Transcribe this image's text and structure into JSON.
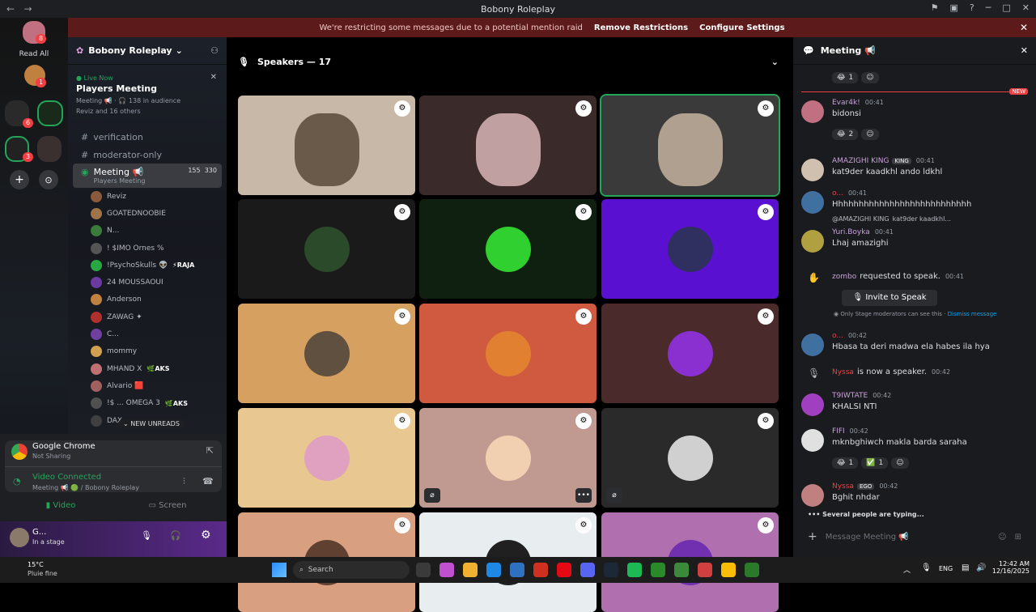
{
  "window": {
    "title": "Bobony Roleplay"
  },
  "banner": {
    "message": "We're restricting some messages due to a potential mention raid",
    "remove": "Remove Restrictions",
    "configure": "Configure Settings"
  },
  "servers": {
    "read_all": "Read All",
    "badge_top": "8",
    "badge_second": "1",
    "badge_group1": "6",
    "badge_group2": "3"
  },
  "guild": {
    "name": "Bobony Roleplay"
  },
  "live": {
    "tag": "Live Now",
    "name": "Players Meeting",
    "meta": "Meeting 📢 · 🎧 138 in audience",
    "others": "Reviz and 16 others"
  },
  "channels": [
    {
      "name": "verification"
    },
    {
      "name": "moderator-only"
    }
  ],
  "voice_channel": {
    "name": "Meeting 📢",
    "subtitle": "Players Meeting",
    "count1": "155",
    "count2": "330"
  },
  "voice_users": [
    {
      "name": "Reviz",
      "color": "#8b5a3c"
    },
    {
      "name": "GOATEDNOOBIE",
      "color": "#a0744a"
    },
    {
      "name": "N...",
      "color": "#3a7a3a"
    },
    {
      "name": "! $IMO Ornes %",
      "color": "#555"
    },
    {
      "name": "!PsychoSkulls 👽",
      "tag": "⚡RAJA",
      "color": "#27a844"
    },
    {
      "name": "24 MOUSSAOUI",
      "color": "#6a3aa0"
    },
    {
      "name": "Anderson",
      "color": "#c08040"
    },
    {
      "name": "ZAWAG ✦",
      "color": "#b03030"
    },
    {
      "name": "C...",
      "color": "#7040a0"
    },
    {
      "name": "mommy",
      "color": "#d0a050"
    },
    {
      "name": "MHAND X",
      "tag": "🌿AKS",
      "color": "#c07070"
    },
    {
      "name": "Alvario 🟥",
      "color": "#a06060"
    },
    {
      "name": "!$ ... OMEGA 3",
      "tag": "🌿AKS",
      "color": "#505050"
    },
    {
      "name": "DAX",
      "color": "#404040"
    }
  ],
  "new_unreads": "NEW UNREADS",
  "panel": {
    "chrome_title": "Google Chrome",
    "chrome_sub": "Not Sharing",
    "connected": "Video Connected",
    "connected_sub": "Meeting 📢 🟢 / Bobony Roleplay",
    "video": "Video",
    "screen": "Screen",
    "user_name": "G...",
    "user_status": "In a stage"
  },
  "stage": {
    "speakers_label": "Speakers — 17"
  },
  "tiles": [
    {
      "bg": "#c8b8a8",
      "av": "#6a5a4a"
    },
    {
      "bg": "#3a2a2a",
      "av": "#c0a0a0"
    },
    {
      "bg": "#3a3a3a",
      "av": "#b0a090"
    },
    {
      "bg": "#1a1a1a",
      "av": "#2a4a2a"
    },
    {
      "bg": "#102010",
      "av": "#2fd02f"
    },
    {
      "bg": "#5a10d0",
      "av": "#303060"
    },
    {
      "bg": "#d6a060",
      "av": "#605040"
    },
    {
      "bg": "#d05a40",
      "av": "#e08030"
    },
    {
      "bg": "#4a2a2a",
      "av": "#8a30d0"
    },
    {
      "bg": "#e8c890",
      "av": "#e0a0c0"
    },
    {
      "bg": "#c09a90",
      "av": "#f0d0b0"
    },
    {
      "bg": "#2a2a2a",
      "av": "#d0d0d0"
    },
    {
      "bg": "#d8a080",
      "av": "#604030"
    },
    {
      "bg": "#e8eef0",
      "av": "#202020"
    },
    {
      "bg": "#b070b0",
      "av": "#7030b0"
    }
  ],
  "chat": {
    "title": "Meeting 📢",
    "new_label": "NEW",
    "messages": [
      {
        "user": "Evar4k!",
        "time": "00:41",
        "text": "bidonsi",
        "color": "#c9a0dc",
        "av": "#c07080"
      },
      {
        "user": "AMAZIGHI KING",
        "tag": "KING",
        "time": "00:41",
        "text": "kat9der kaadkhl ando ldkhl",
        "color": "#c9a0dc",
        "av": "#d0c0b0"
      },
      {
        "user": "o...",
        "time": "00:41",
        "text": "Hhhhhhhhhhhhhhhhhhhhhhhhhhh",
        "color": "#f23f43",
        "av": "#4070a0"
      },
      {
        "user": "Yuri.Boyka",
        "time": "00:41",
        "text": "Lhaj amazighi",
        "color": "#c9a0dc",
        "av": "#b0a040",
        "reply": "@AMAZIGHI KING",
        "reply_text": "kat9der kaadkhl..."
      },
      {
        "user": "zombo",
        "time": "00:41",
        "text": "requested to speak.",
        "color": "#c9a0dc"
      },
      {
        "user": "o...",
        "time": "00:42",
        "text": "Hbasa ta deri madwa ela habes ila hya",
        "color": "#f23f43",
        "av": "#4070a0"
      },
      {
        "user": "Nyssa",
        "time": "00:42",
        "text": "is now a speaker.",
        "color": "#f23f43"
      },
      {
        "user": "T9IWTATE",
        "time": "00:42",
        "text": "KHALSI NTI",
        "color": "#c9a0dc",
        "av": "#a040c0"
      },
      {
        "user": "FIFI",
        "time": "00:42",
        "text": "mknbghiwch makla barda saraha",
        "color": "#c9a0dc",
        "av": "#e0e0e0"
      },
      {
        "user": "Nyssa",
        "tag": "EGO",
        "time": "00:42",
        "text": "Bghit nhdar",
        "color": "#f23f43",
        "av": "#c08080"
      }
    ],
    "invite_button": "Invite to Speak",
    "moderator_note": "Only Stage moderators can see this",
    "dismiss": "Dismiss message",
    "reactions": {
      "r1": "1",
      "r2": "2",
      "r3": "1",
      "r4": "1"
    },
    "typing": "Several people are typing...",
    "placeholder": "Message Meeting 📢"
  },
  "taskbar": {
    "weather_temp": "15°C",
    "weather_desc": "Pluie fine",
    "search": "Search",
    "lang": "ENG",
    "time": "12:42 AM",
    "date": "12/16/2025"
  }
}
